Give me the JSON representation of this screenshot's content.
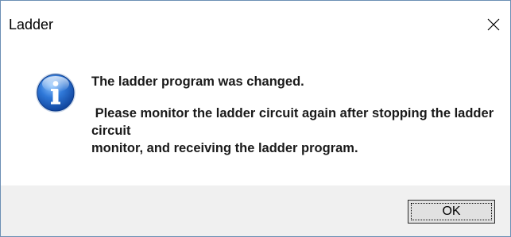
{
  "window": {
    "title": "Ladder"
  },
  "titlebar": {
    "close_icon": "close-icon"
  },
  "dialog": {
    "icon": "info-icon",
    "message_line1": "The ladder program was changed.",
    "message_line2": " Please monitor the ladder circuit again after stopping the ladder circuit",
    "message_line3": "monitor, and receiving the ladder program."
  },
  "buttons": {
    "ok_label": "OK"
  },
  "colors": {
    "border": "#6c8fb4",
    "footer_bg": "#f0f0f0",
    "button_bg": "#e1e1e1",
    "icon_blue": "#1e5fbf"
  }
}
